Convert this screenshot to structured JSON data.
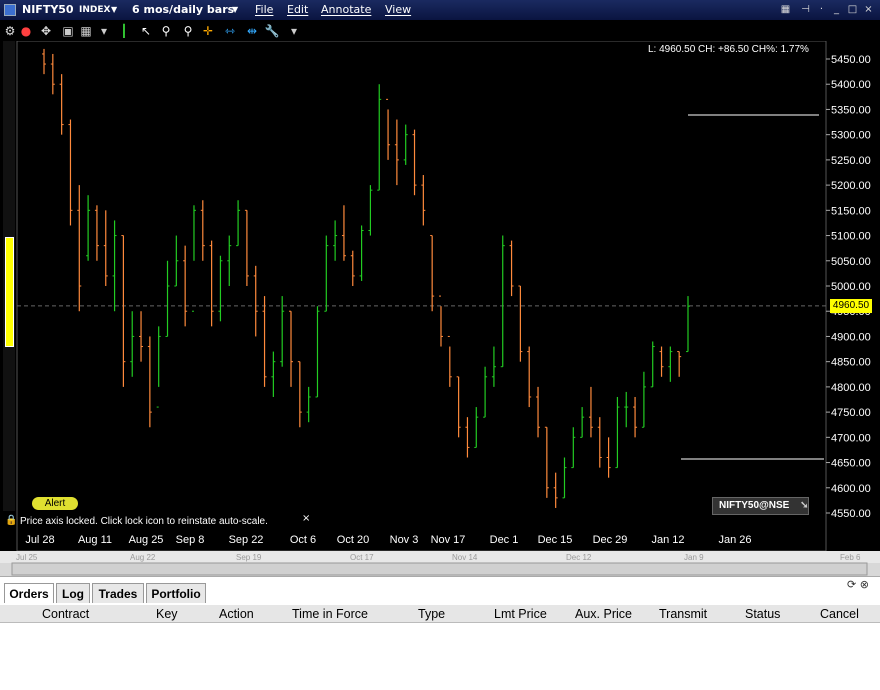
{
  "titlebar": {
    "symbol": "NIFTY50",
    "type": "INDEX",
    "period": "6 mos/daily bars",
    "menus": [
      "File",
      "Edit",
      "Annotate",
      "View"
    ]
  },
  "stats": "L: 4960.50  CH: +86.50  CH%: 1.77%",
  "price_tag": "4960.50",
  "alert_label": "Alert",
  "lock_note": "Price axis locked. Click lock icon to reinstate auto-scale.",
  "close_x": "×",
  "symbol_badge": "NIFTY50@NSE",
  "colors": {
    "up": "#22cc22",
    "down": "#ff8a3c",
    "grid": "#333333",
    "yellow": "#ffff00"
  },
  "chart_data": {
    "type": "bar",
    "yticks": [
      5450,
      5400,
      5350,
      5300,
      5250,
      5200,
      5150,
      5100,
      5050,
      5000,
      4950,
      4900,
      4850,
      4800,
      4750,
      4700,
      4650,
      4600,
      4550
    ],
    "ylim": [
      4535,
      5470
    ],
    "x_labels": [
      "Jul 28",
      "Aug 11",
      "Aug 25",
      "Sep 8",
      "Sep 22",
      "Oct 6",
      "Oct 20",
      "Nov 3",
      "Nov 17",
      "Dec 1",
      "Dec 15",
      "Dec 29",
      "Jan 12",
      "Jan 26"
    ],
    "sub_labels": [
      "Jul 25",
      "Aug 22",
      "Sep 19",
      "Oct 17",
      "Nov 14",
      "Dec 12",
      "Jan 9",
      "Feb 6"
    ],
    "last_price": 4960.5,
    "ohlc": [
      [
        5470,
        5420,
        5460,
        5440
      ],
      [
        5460,
        5380,
        5440,
        5400
      ],
      [
        5420,
        5300,
        5400,
        5320
      ],
      [
        5330,
        5120,
        5320,
        5150
      ],
      [
        5200,
        4950,
        5150,
        5000
      ],
      [
        5180,
        5050,
        5060,
        5150
      ],
      [
        5160,
        5050,
        5150,
        5080
      ],
      [
        5150,
        5000,
        5080,
        5020
      ],
      [
        5130,
        4950,
        5020,
        5100
      ],
      [
        5100,
        4800,
        5100,
        4850
      ],
      [
        4950,
        4820,
        4850,
        4900
      ],
      [
        4950,
        4850,
        4900,
        4880
      ],
      [
        4900,
        4720,
        4880,
        4750
      ],
      [
        4920,
        4800,
        4760,
        4900
      ],
      [
        5050,
        4900,
        4900,
        5000
      ],
      [
        5100,
        5000,
        5000,
        5050
      ],
      [
        5080,
        4920,
        5050,
        4950
      ],
      [
        5160,
        5050,
        4950,
        5150
      ],
      [
        5170,
        5050,
        5150,
        5080
      ],
      [
        5090,
        4920,
        5080,
        4950
      ],
      [
        5060,
        4930,
        4950,
        5050
      ],
      [
        5100,
        5000,
        5050,
        5080
      ],
      [
        5170,
        5080,
        5080,
        5150
      ],
      [
        5150,
        5000,
        5150,
        5020
      ],
      [
        5040,
        4900,
        5020,
        4950
      ],
      [
        4980,
        4800,
        4950,
        4820
      ],
      [
        4870,
        4780,
        4820,
        4850
      ],
      [
        4980,
        4840,
        4850,
        4950
      ],
      [
        4950,
        4800,
        4950,
        4850
      ],
      [
        4850,
        4720,
        4850,
        4750
      ],
      [
        4800,
        4730,
        4750,
        4780
      ],
      [
        4960,
        4780,
        4780,
        4950
      ],
      [
        5100,
        4950,
        4950,
        5080
      ],
      [
        5130,
        5050,
        5080,
        5100
      ],
      [
        5160,
        5050,
        5100,
        5060
      ],
      [
        5070,
        5000,
        5060,
        5020
      ],
      [
        5120,
        5010,
        5020,
        5110
      ],
      [
        5200,
        5100,
        5110,
        5190
      ],
      [
        5400,
        5190,
        5190,
        5370
      ],
      [
        5350,
        5250,
        5370,
        5280
      ],
      [
        5330,
        5200,
        5280,
        5250
      ],
      [
        5320,
        5240,
        5250,
        5300
      ],
      [
        5310,
        5180,
        5300,
        5200
      ],
      [
        5220,
        5120,
        5200,
        5150
      ],
      [
        5100,
        4950,
        5100,
        4980
      ],
      [
        4960,
        4880,
        4980,
        4900
      ],
      [
        4880,
        4800,
        4900,
        4820
      ],
      [
        4820,
        4700,
        4820,
        4720
      ],
      [
        4740,
        4660,
        4720,
        4680
      ],
      [
        4760,
        4680,
        4680,
        4740
      ],
      [
        4840,
        4740,
        4740,
        4820
      ],
      [
        4880,
        4800,
        4820,
        4840
      ],
      [
        5100,
        4840,
        4840,
        5080
      ],
      [
        5090,
        4980,
        5080,
        5000
      ],
      [
        5000,
        4850,
        5000,
        4870
      ],
      [
        4880,
        4760,
        4870,
        4780
      ],
      [
        4800,
        4700,
        4780,
        4720
      ],
      [
        4720,
        4580,
        4720,
        4600
      ],
      [
        4630,
        4560,
        4600,
        4580
      ],
      [
        4660,
        4580,
        4580,
        4640
      ],
      [
        4720,
        4640,
        4640,
        4700
      ],
      [
        4760,
        4700,
        4700,
        4740
      ],
      [
        4800,
        4700,
        4740,
        4720
      ],
      [
        4740,
        4640,
        4720,
        4660
      ],
      [
        4700,
        4620,
        4660,
        4640
      ],
      [
        4780,
        4640,
        4640,
        4760
      ],
      [
        4790,
        4720,
        4760,
        4760
      ],
      [
        4780,
        4700,
        4760,
        4720
      ],
      [
        4830,
        4720,
        4720,
        4800
      ],
      [
        4890,
        4800,
        4800,
        4880
      ],
      [
        4880,
        4820,
        4870,
        4840
      ],
      [
        4880,
        4810,
        4840,
        4870
      ],
      [
        4870,
        4820,
        4870,
        4860
      ],
      [
        4980,
        4870,
        4870,
        4960
      ]
    ]
  },
  "orders": {
    "tabs": [
      "Orders",
      "Log",
      "Trades",
      "Portfolio"
    ],
    "columns": [
      "Contract",
      "Key",
      "Action",
      "Time in Force",
      "Type",
      "Lmt Price",
      "Aux. Price",
      "Transmit",
      "Status",
      "Cancel"
    ]
  }
}
